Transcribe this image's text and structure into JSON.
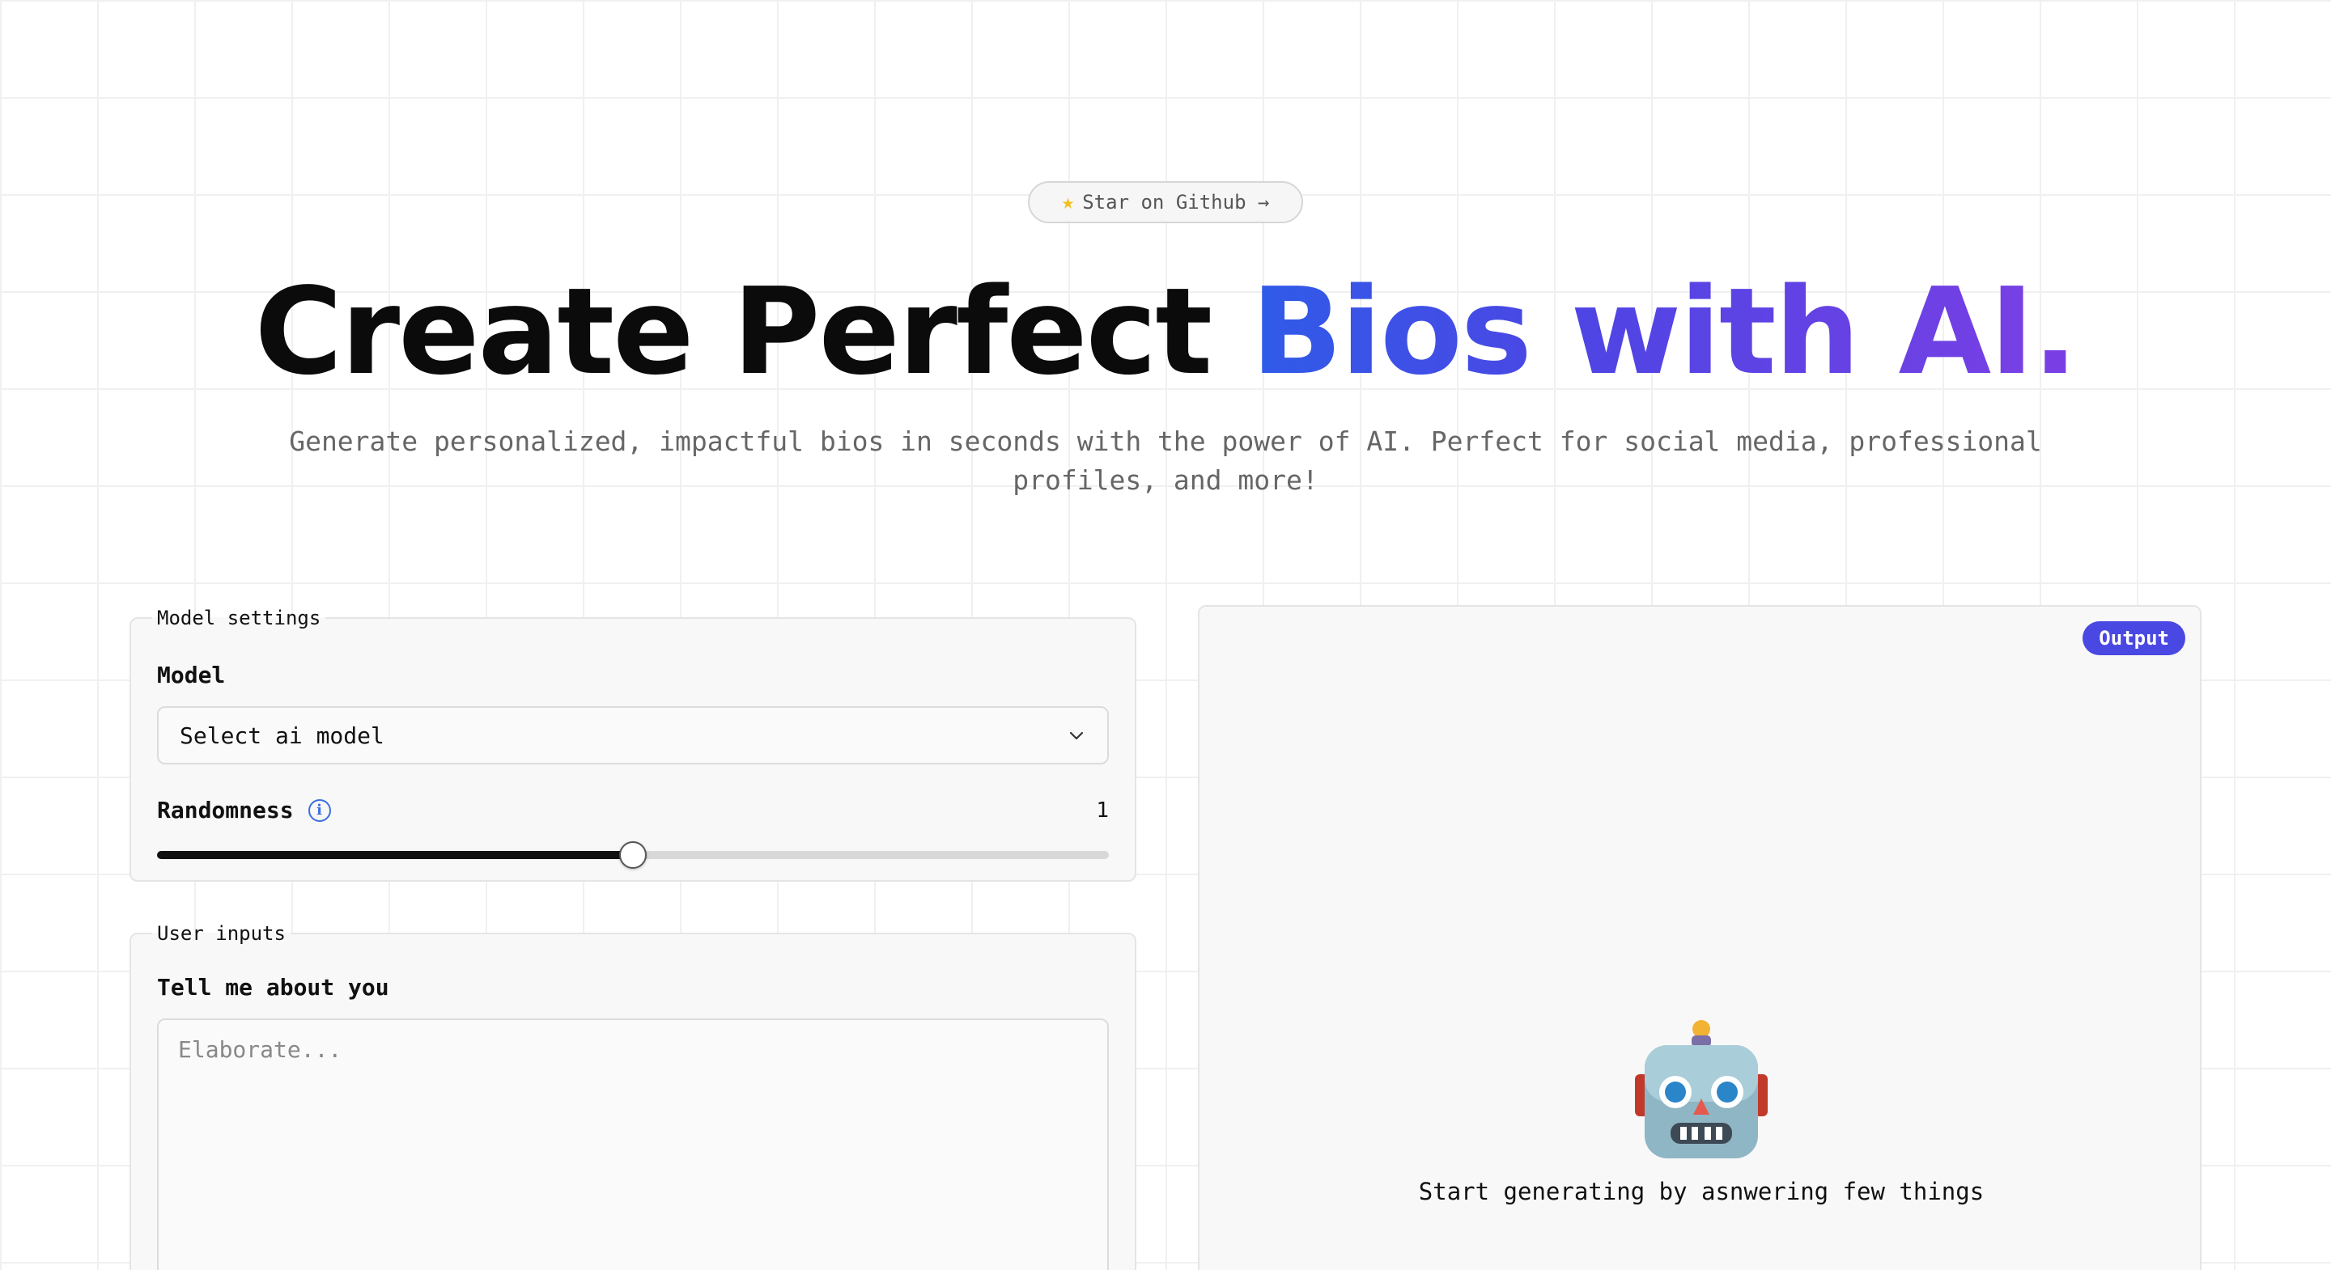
{
  "github_pill": {
    "label": "Star on Github →",
    "star_icon": "star-icon"
  },
  "headline": {
    "plain": "Create Perfect ",
    "highlight": "Bios with AI."
  },
  "subtitle": "Generate personalized, impactful bios in seconds with the power of AI. Perfect for social media, professional profiles, and more!",
  "model_settings": {
    "legend": "Model settings",
    "model_label": "Model",
    "model_placeholder": "Select ai model",
    "randomness_label": "Randomness",
    "randomness_value": "1",
    "randomness_fraction": 0.5
  },
  "user_inputs": {
    "legend": "User inputs",
    "about_label": "Tell me about you",
    "about_placeholder": "Elaborate..."
  },
  "output": {
    "badge": "Output",
    "empty_icon": "robot-icon",
    "empty_text": "Start generating by asnwering few things"
  },
  "colors": {
    "accent": "#4a48e2",
    "gradient_start": "#2f5be8",
    "gradient_end": "#7b3fe4",
    "info": "#3b6fe0"
  }
}
